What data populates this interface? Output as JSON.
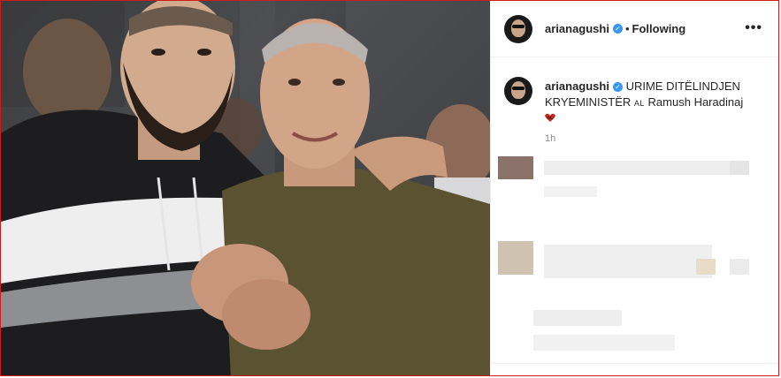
{
  "post": {
    "author": {
      "username": "arianagushi",
      "verified": true,
      "avatar_icon": "profile-avatar-icon"
    },
    "follow_separator": "•",
    "follow_status": "Following",
    "more_icon": "more-options-icon",
    "caption": {
      "username": "arianagushi",
      "line1": "URIME DITËLINDJEN",
      "line2_prefix": "KRYEMINISTËR",
      "line2_al": "AL",
      "line2_suffix": "Ramush Haradinaj",
      "emoji": "heart-emoji"
    },
    "timestamp": "1h",
    "comments_state": "blurred"
  },
  "colors": {
    "accent_blue": "#3897f0",
    "border_red": "#d11a1a",
    "emoji_red": "#c0281d"
  }
}
